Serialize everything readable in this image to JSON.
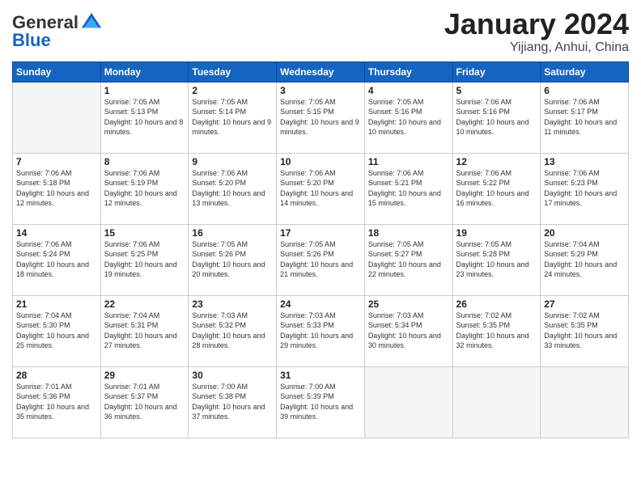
{
  "header": {
    "logo_general": "General",
    "logo_blue": "Blue",
    "month_title": "January 2024",
    "location": "Yijiang, Anhui, China"
  },
  "days_of_week": [
    "Sunday",
    "Monday",
    "Tuesday",
    "Wednesday",
    "Thursday",
    "Friday",
    "Saturday"
  ],
  "weeks": [
    [
      {
        "day": null,
        "info": null
      },
      {
        "day": "1",
        "sunrise": "Sunrise: 7:05 AM",
        "sunset": "Sunset: 5:13 PM",
        "daylight": "Daylight: 10 hours and 8 minutes."
      },
      {
        "day": "2",
        "sunrise": "Sunrise: 7:05 AM",
        "sunset": "Sunset: 5:14 PM",
        "daylight": "Daylight: 10 hours and 9 minutes."
      },
      {
        "day": "3",
        "sunrise": "Sunrise: 7:05 AM",
        "sunset": "Sunset: 5:15 PM",
        "daylight": "Daylight: 10 hours and 9 minutes."
      },
      {
        "day": "4",
        "sunrise": "Sunrise: 7:05 AM",
        "sunset": "Sunset: 5:16 PM",
        "daylight": "Daylight: 10 hours and 10 minutes."
      },
      {
        "day": "5",
        "sunrise": "Sunrise: 7:06 AM",
        "sunset": "Sunset: 5:16 PM",
        "daylight": "Daylight: 10 hours and 10 minutes."
      },
      {
        "day": "6",
        "sunrise": "Sunrise: 7:06 AM",
        "sunset": "Sunset: 5:17 PM",
        "daylight": "Daylight: 10 hours and 11 minutes."
      }
    ],
    [
      {
        "day": "7",
        "sunrise": "Sunrise: 7:06 AM",
        "sunset": "Sunset: 5:18 PM",
        "daylight": "Daylight: 10 hours and 12 minutes."
      },
      {
        "day": "8",
        "sunrise": "Sunrise: 7:06 AM",
        "sunset": "Sunset: 5:19 PM",
        "daylight": "Daylight: 10 hours and 12 minutes."
      },
      {
        "day": "9",
        "sunrise": "Sunrise: 7:06 AM",
        "sunset": "Sunset: 5:20 PM",
        "daylight": "Daylight: 10 hours and 13 minutes."
      },
      {
        "day": "10",
        "sunrise": "Sunrise: 7:06 AM",
        "sunset": "Sunset: 5:20 PM",
        "daylight": "Daylight: 10 hours and 14 minutes."
      },
      {
        "day": "11",
        "sunrise": "Sunrise: 7:06 AM",
        "sunset": "Sunset: 5:21 PM",
        "daylight": "Daylight: 10 hours and 15 minutes."
      },
      {
        "day": "12",
        "sunrise": "Sunrise: 7:06 AM",
        "sunset": "Sunset: 5:22 PM",
        "daylight": "Daylight: 10 hours and 16 minutes."
      },
      {
        "day": "13",
        "sunrise": "Sunrise: 7:06 AM",
        "sunset": "Sunset: 5:23 PM",
        "daylight": "Daylight: 10 hours and 17 minutes."
      }
    ],
    [
      {
        "day": "14",
        "sunrise": "Sunrise: 7:06 AM",
        "sunset": "Sunset: 5:24 PM",
        "daylight": "Daylight: 10 hours and 18 minutes."
      },
      {
        "day": "15",
        "sunrise": "Sunrise: 7:06 AM",
        "sunset": "Sunset: 5:25 PM",
        "daylight": "Daylight: 10 hours and 19 minutes."
      },
      {
        "day": "16",
        "sunrise": "Sunrise: 7:05 AM",
        "sunset": "Sunset: 5:26 PM",
        "daylight": "Daylight: 10 hours and 20 minutes."
      },
      {
        "day": "17",
        "sunrise": "Sunrise: 7:05 AM",
        "sunset": "Sunset: 5:26 PM",
        "daylight": "Daylight: 10 hours and 21 minutes."
      },
      {
        "day": "18",
        "sunrise": "Sunrise: 7:05 AM",
        "sunset": "Sunset: 5:27 PM",
        "daylight": "Daylight: 10 hours and 22 minutes."
      },
      {
        "day": "19",
        "sunrise": "Sunrise: 7:05 AM",
        "sunset": "Sunset: 5:28 PM",
        "daylight": "Daylight: 10 hours and 23 minutes."
      },
      {
        "day": "20",
        "sunrise": "Sunrise: 7:04 AM",
        "sunset": "Sunset: 5:29 PM",
        "daylight": "Daylight: 10 hours and 24 minutes."
      }
    ],
    [
      {
        "day": "21",
        "sunrise": "Sunrise: 7:04 AM",
        "sunset": "Sunset: 5:30 PM",
        "daylight": "Daylight: 10 hours and 25 minutes."
      },
      {
        "day": "22",
        "sunrise": "Sunrise: 7:04 AM",
        "sunset": "Sunset: 5:31 PM",
        "daylight": "Daylight: 10 hours and 27 minutes."
      },
      {
        "day": "23",
        "sunrise": "Sunrise: 7:03 AM",
        "sunset": "Sunset: 5:32 PM",
        "daylight": "Daylight: 10 hours and 28 minutes."
      },
      {
        "day": "24",
        "sunrise": "Sunrise: 7:03 AM",
        "sunset": "Sunset: 5:33 PM",
        "daylight": "Daylight: 10 hours and 29 minutes."
      },
      {
        "day": "25",
        "sunrise": "Sunrise: 7:03 AM",
        "sunset": "Sunset: 5:34 PM",
        "daylight": "Daylight: 10 hours and 30 minutes."
      },
      {
        "day": "26",
        "sunrise": "Sunrise: 7:02 AM",
        "sunset": "Sunset: 5:35 PM",
        "daylight": "Daylight: 10 hours and 32 minutes."
      },
      {
        "day": "27",
        "sunrise": "Sunrise: 7:02 AM",
        "sunset": "Sunset: 5:35 PM",
        "daylight": "Daylight: 10 hours and 33 minutes."
      }
    ],
    [
      {
        "day": "28",
        "sunrise": "Sunrise: 7:01 AM",
        "sunset": "Sunset: 5:36 PM",
        "daylight": "Daylight: 10 hours and 35 minutes."
      },
      {
        "day": "29",
        "sunrise": "Sunrise: 7:01 AM",
        "sunset": "Sunset: 5:37 PM",
        "daylight": "Daylight: 10 hours and 36 minutes."
      },
      {
        "day": "30",
        "sunrise": "Sunrise: 7:00 AM",
        "sunset": "Sunset: 5:38 PM",
        "daylight": "Daylight: 10 hours and 37 minutes."
      },
      {
        "day": "31",
        "sunrise": "Sunrise: 7:00 AM",
        "sunset": "Sunset: 5:39 PM",
        "daylight": "Daylight: 10 hours and 39 minutes."
      },
      {
        "day": null,
        "info": null
      },
      {
        "day": null,
        "info": null
      },
      {
        "day": null,
        "info": null
      }
    ]
  ]
}
